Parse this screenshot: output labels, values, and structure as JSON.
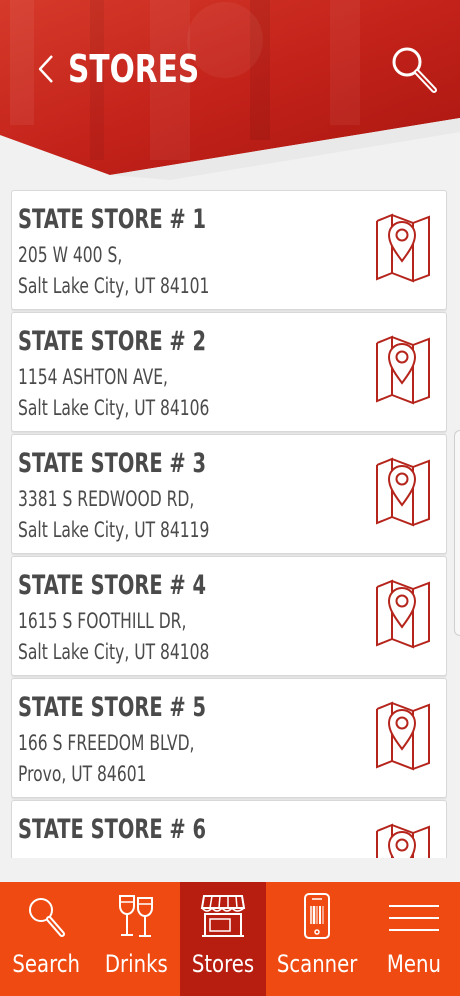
{
  "header": {
    "title": "STORES"
  },
  "stores": [
    {
      "name": "STATE STORE # 1",
      "address": "205 W 400 S,",
      "city": "Salt Lake City, UT 84101"
    },
    {
      "name": "STATE STORE # 2",
      "address": "1154 ASHTON AVE,",
      "city": "Salt Lake City, UT 84106"
    },
    {
      "name": "STATE STORE # 3",
      "address": "3381 S REDWOOD RD,",
      "city": "Salt Lake City, UT 84119"
    },
    {
      "name": "STATE STORE # 4",
      "address": "1615 S FOOTHILL DR,",
      "city": "Salt Lake City, UT 84108"
    },
    {
      "name": "STATE STORE # 5",
      "address": "166 S FREEDOM BLVD,",
      "city": "Provo, UT 84601"
    },
    {
      "name": "STATE STORE # 6",
      "address": "",
      "city": ""
    }
  ],
  "nav": {
    "items": [
      {
        "label": "Search",
        "icon": "search-icon",
        "active": false
      },
      {
        "label": "Drinks",
        "icon": "wine-glasses-icon",
        "active": false
      },
      {
        "label": "Stores",
        "icon": "storefront-icon",
        "active": true
      },
      {
        "label": "Scanner",
        "icon": "phone-barcode-icon",
        "active": false
      },
      {
        "label": "Menu",
        "icon": "hamburger-menu-icon",
        "active": false
      }
    ]
  },
  "colors": {
    "header_red": "#c8241a",
    "nav_orange": "#ef4a11",
    "nav_active": "#b81e10",
    "map_icon": "#b5251c"
  }
}
